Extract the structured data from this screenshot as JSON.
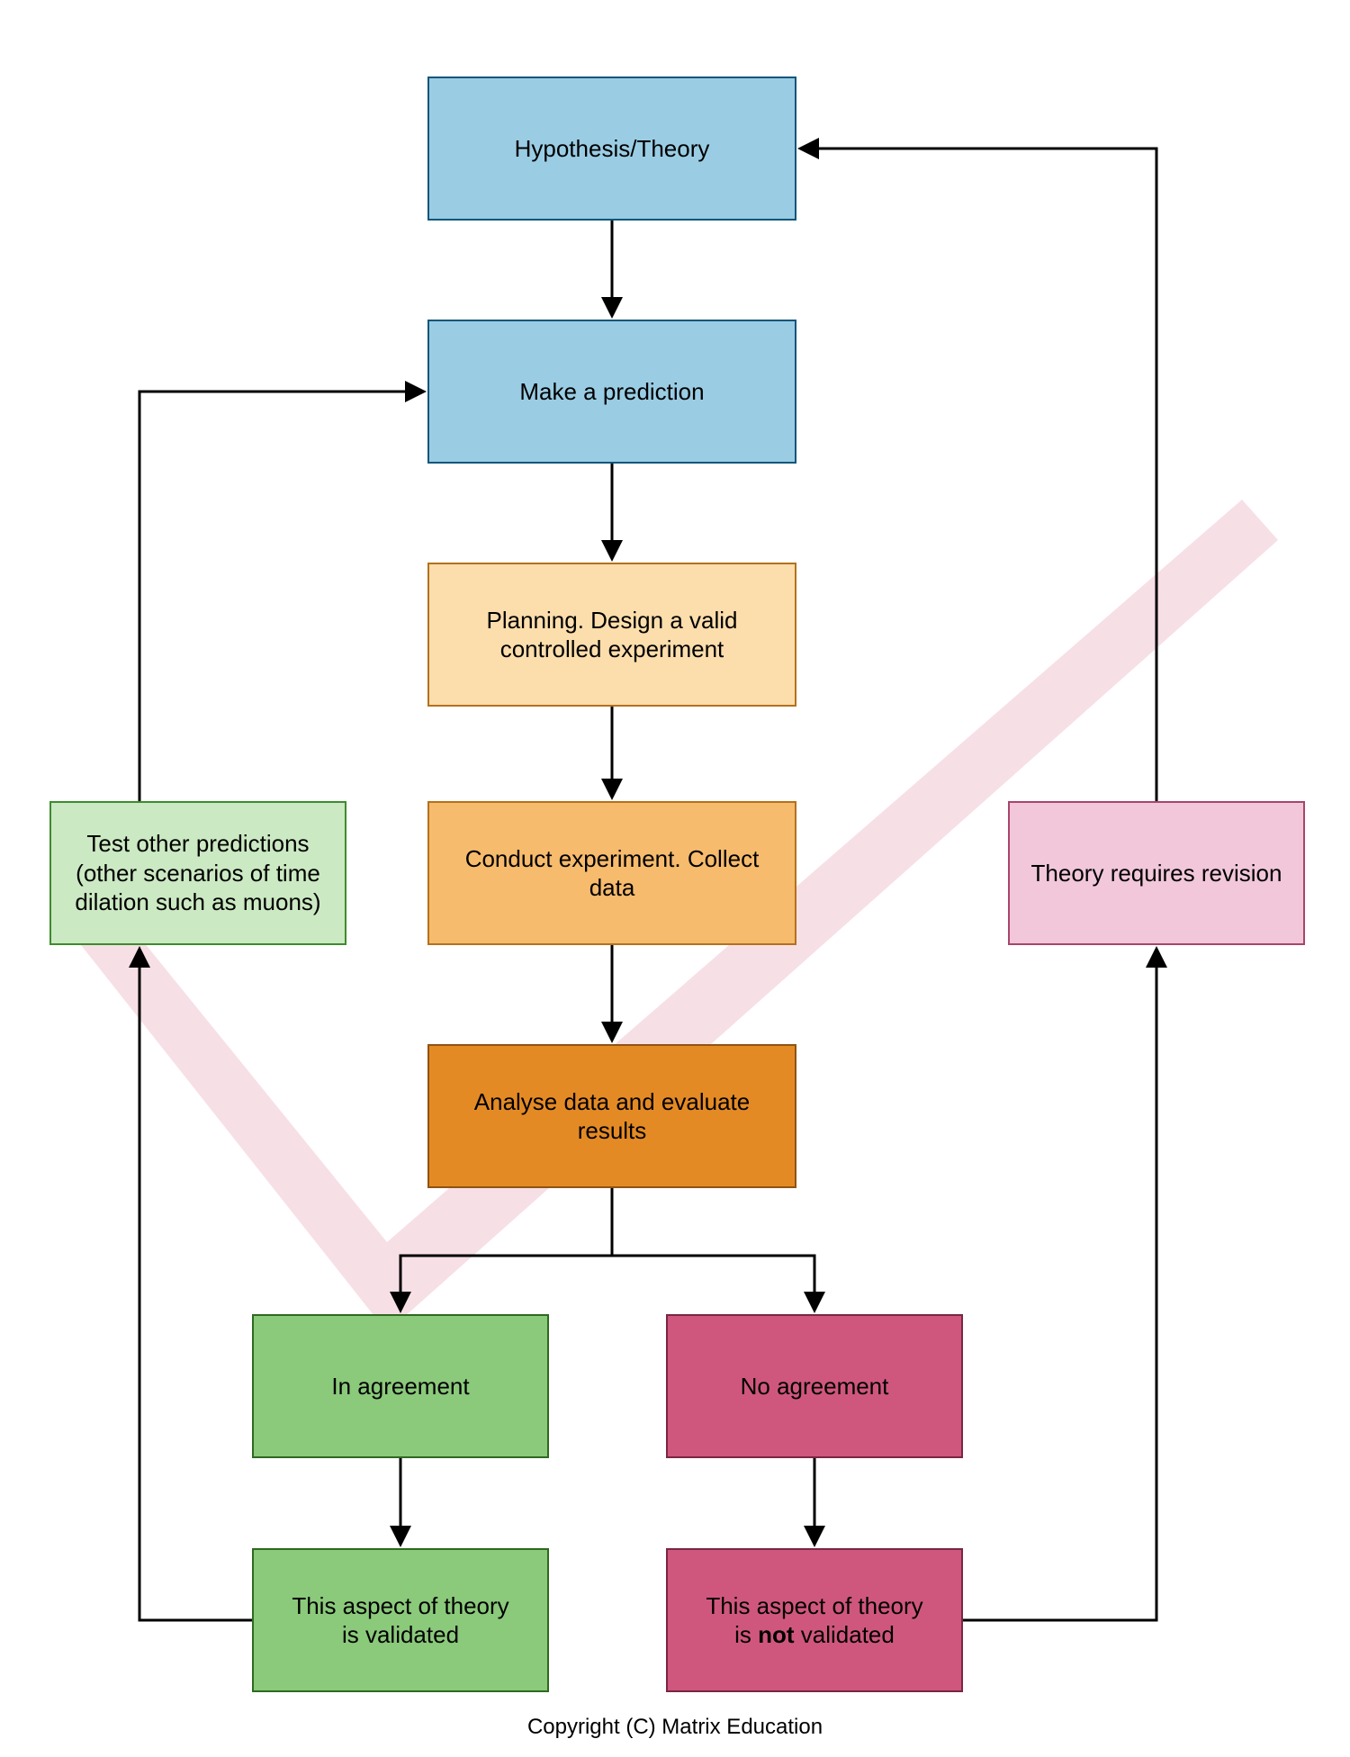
{
  "chart_data": {
    "type": "flowchart",
    "nodes": [
      {
        "id": "hypothesis",
        "label": "Hypothesis/Theory",
        "fill": "#9ACDE4",
        "stroke": "#0F567A"
      },
      {
        "id": "prediction",
        "label": "Make a prediction",
        "fill": "#9ACDE4",
        "stroke": "#0F567A"
      },
      {
        "id": "planning",
        "label": "Planning. Design a valid\ncontrolled experiment",
        "fill": "#FCDDAC",
        "stroke": "#B4711C"
      },
      {
        "id": "conduct",
        "label": "Conduct experiment.\nCollect data",
        "fill": "#F6BB6D",
        "stroke": "#B4711C"
      },
      {
        "id": "analyse",
        "label": "Analyse data and evaluate results",
        "fill": "#E48A25",
        "stroke": "#8F5411"
      },
      {
        "id": "in_agree",
        "label": "In agreement",
        "fill": "#8BC97B",
        "stroke": "#2E6A21"
      },
      {
        "id": "validated",
        "label": "This aspect of theory\nis validated",
        "fill": "#8BC97B",
        "stroke": "#2E6A21"
      },
      {
        "id": "test_other",
        "label": "Test other predictions\n(other scenarios of time\ndilation such as muons)",
        "fill": "#CBE9C2",
        "stroke": "#3E8B2E"
      },
      {
        "id": "no_agree",
        "label": "No agreement",
        "fill": "#CF577E",
        "stroke": "#7B2544"
      },
      {
        "id": "not_validated",
        "label_html": "This aspect of theory<br>is <b>not</b> validated",
        "fill": "#CF577E",
        "stroke": "#7B2544"
      },
      {
        "id": "revision",
        "label": "Theory requires\nrevision",
        "fill": "#F1C7D9",
        "stroke": "#A8456B"
      }
    ],
    "edges": [
      {
        "from": "hypothesis",
        "to": "prediction"
      },
      {
        "from": "prediction",
        "to": "planning"
      },
      {
        "from": "planning",
        "to": "conduct"
      },
      {
        "from": "conduct",
        "to": "analyse"
      },
      {
        "from": "analyse",
        "to": "in_agree"
      },
      {
        "from": "analyse",
        "to": "no_agree"
      },
      {
        "from": "in_agree",
        "to": "validated"
      },
      {
        "from": "no_agree",
        "to": "not_validated"
      },
      {
        "from": "validated",
        "to": "test_other"
      },
      {
        "from": "test_other",
        "to": "prediction"
      },
      {
        "from": "not_validated",
        "to": "revision"
      },
      {
        "from": "revision",
        "to": "hypothesis"
      }
    ]
  },
  "boxes": {
    "hypothesis": "Hypothesis/Theory",
    "prediction": "Make a prediction",
    "planning": "Planning. Design a valid controlled experiment",
    "conduct": "Conduct experiment. Collect data",
    "analyse": "Analyse data and evaluate results",
    "in_agree": "In agreement",
    "validated_l1": "This aspect of theory",
    "validated_l2": "is validated",
    "no_agree": "No agreement",
    "not_validated_l1": "This aspect of theory",
    "not_validated_l2a": "is ",
    "not_validated_bold": "not",
    "not_validated_l2b": " validated",
    "test_other": "Test other predictions (other scenarios of time dilation such as muons)",
    "revision": "Theory requires revision"
  },
  "copyright": "Copyright (C) Matrix Education"
}
